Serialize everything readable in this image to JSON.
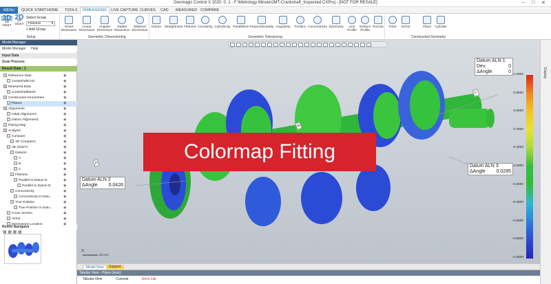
{
  "window": {
    "title": "Geomagic Control X 2020. 0. 1 - F:\\Metrology Minute\\JMT-Crankshaft_Inspected.CXProj - [NOT FOR RESALE]"
  },
  "menu_tabs": [
    "MENU",
    "QUICK START",
    "HOME",
    "TOOLS",
    "DIMENSIONS",
    "LIVE CAPTURE",
    "CURVES",
    "CAD",
    "MEASURED",
    "COMPARE"
  ],
  "ribbon": {
    "setup": {
      "label": "Setup",
      "btn3d": "3D",
      "btn3d_sub": "3D GD&T",
      "btn2d": "2D",
      "btn2d_sub": "2D GD&T",
      "select_group": "Select Group",
      "flatness": "Flatness",
      "add_group": "+ Add Group"
    },
    "geometric_dimensioning": {
      "label": "Geometric Dimensioning",
      "buttons": [
        "Smart Dimension",
        "Linear Dimension",
        "Angular Dimension",
        "Radial Dimension",
        "Elliptical Dimension"
      ]
    },
    "geometric_tolerancing": {
      "label": "Geometric Tolerancing",
      "buttons": [
        "Datum",
        "Straightness",
        "Flatness",
        "Circularity",
        "Cylindricity",
        "Parallelism",
        "Perpendicularity",
        "Angularity",
        "Position",
        "Concentricity",
        "Symmetry",
        "Line Profile",
        "Surface Profile",
        "Runout"
      ]
    },
    "constructed_geometry": {
      "label": "Constructed Geometry",
      "buttons": [
        "Point",
        "Vector",
        "Plane",
        "Cylinder"
      ]
    }
  },
  "left_panel": {
    "header": "Model Manager",
    "toolbar": [
      "Model Manager",
      "Help"
    ],
    "input_data": "Input Data",
    "scan_process": "Scan Process",
    "result_data": "Result Data - 1",
    "tree": [
      "Reference Data",
      "CrankshaftCAD",
      "Measured Data",
      "CrankshaftMesh",
      "Constructed Geometries",
      "Plane1",
      "Alignments",
      "Initial Alignment1",
      "Datum Alignment1",
      "Pairing Map",
      "Analysis",
      "Compare",
      "3D Compare1",
      "3D GD&T1",
      "Datums",
      "A",
      "B",
      "C",
      "Flatness",
      "Parallel to Datum B",
      "Parallel to Datum B",
      "Concentricity",
      "Concentricity to Datu...",
      "True Position",
      "True Position to Datu...",
      "Cross Section",
      "Airfoil",
      "Dimensions Location"
    ],
    "result_navigator": "Result Navigator"
  },
  "callouts": {
    "aln1": {
      "title": "Datum ALN 1",
      "row1_label": "Dev.",
      "row1_value": "0",
      "row2_label": "ΔAngle",
      "row2_value": "0"
    },
    "aln2": {
      "title": "Datum ALN 2",
      "row1_label": "ΔAngle",
      "row1_value": "0.0426"
    },
    "aln3": {
      "title": "Datum ALN 3",
      "row1_label": "ΔAngle",
      "row1_value": "0.0285"
    }
  },
  "datum_tags": [
    "A",
    "B",
    "C"
  ],
  "banner": "Colormap Fitting",
  "colorbar": {
    "labels": [
      "1.0000",
      "0.8000",
      "0.6000",
      "0.4000",
      "0.2000",
      "0.0000",
      "-0.2000",
      "-0.4000",
      "-0.6000",
      "-0.8000",
      "-1.0000"
    ],
    "colors": [
      "#e1261c",
      "#f08b1d",
      "#f6c324",
      "#e7e52c",
      "#a9d93a",
      "#2fbf3a",
      "#2fbf3a",
      "#2fb8d8",
      "#2a7fd9",
      "#2b4bd6",
      "#2525b8"
    ]
  },
  "scale_text": "25 mm",
  "right_strip": "Display",
  "view_tabs": [
    "Model View",
    "Support"
  ],
  "tabular": {
    "header": "Tabular View - Plane (Auto)",
    "tabs": [
      "Tabular View",
      "Console",
      "Error List"
    ]
  }
}
